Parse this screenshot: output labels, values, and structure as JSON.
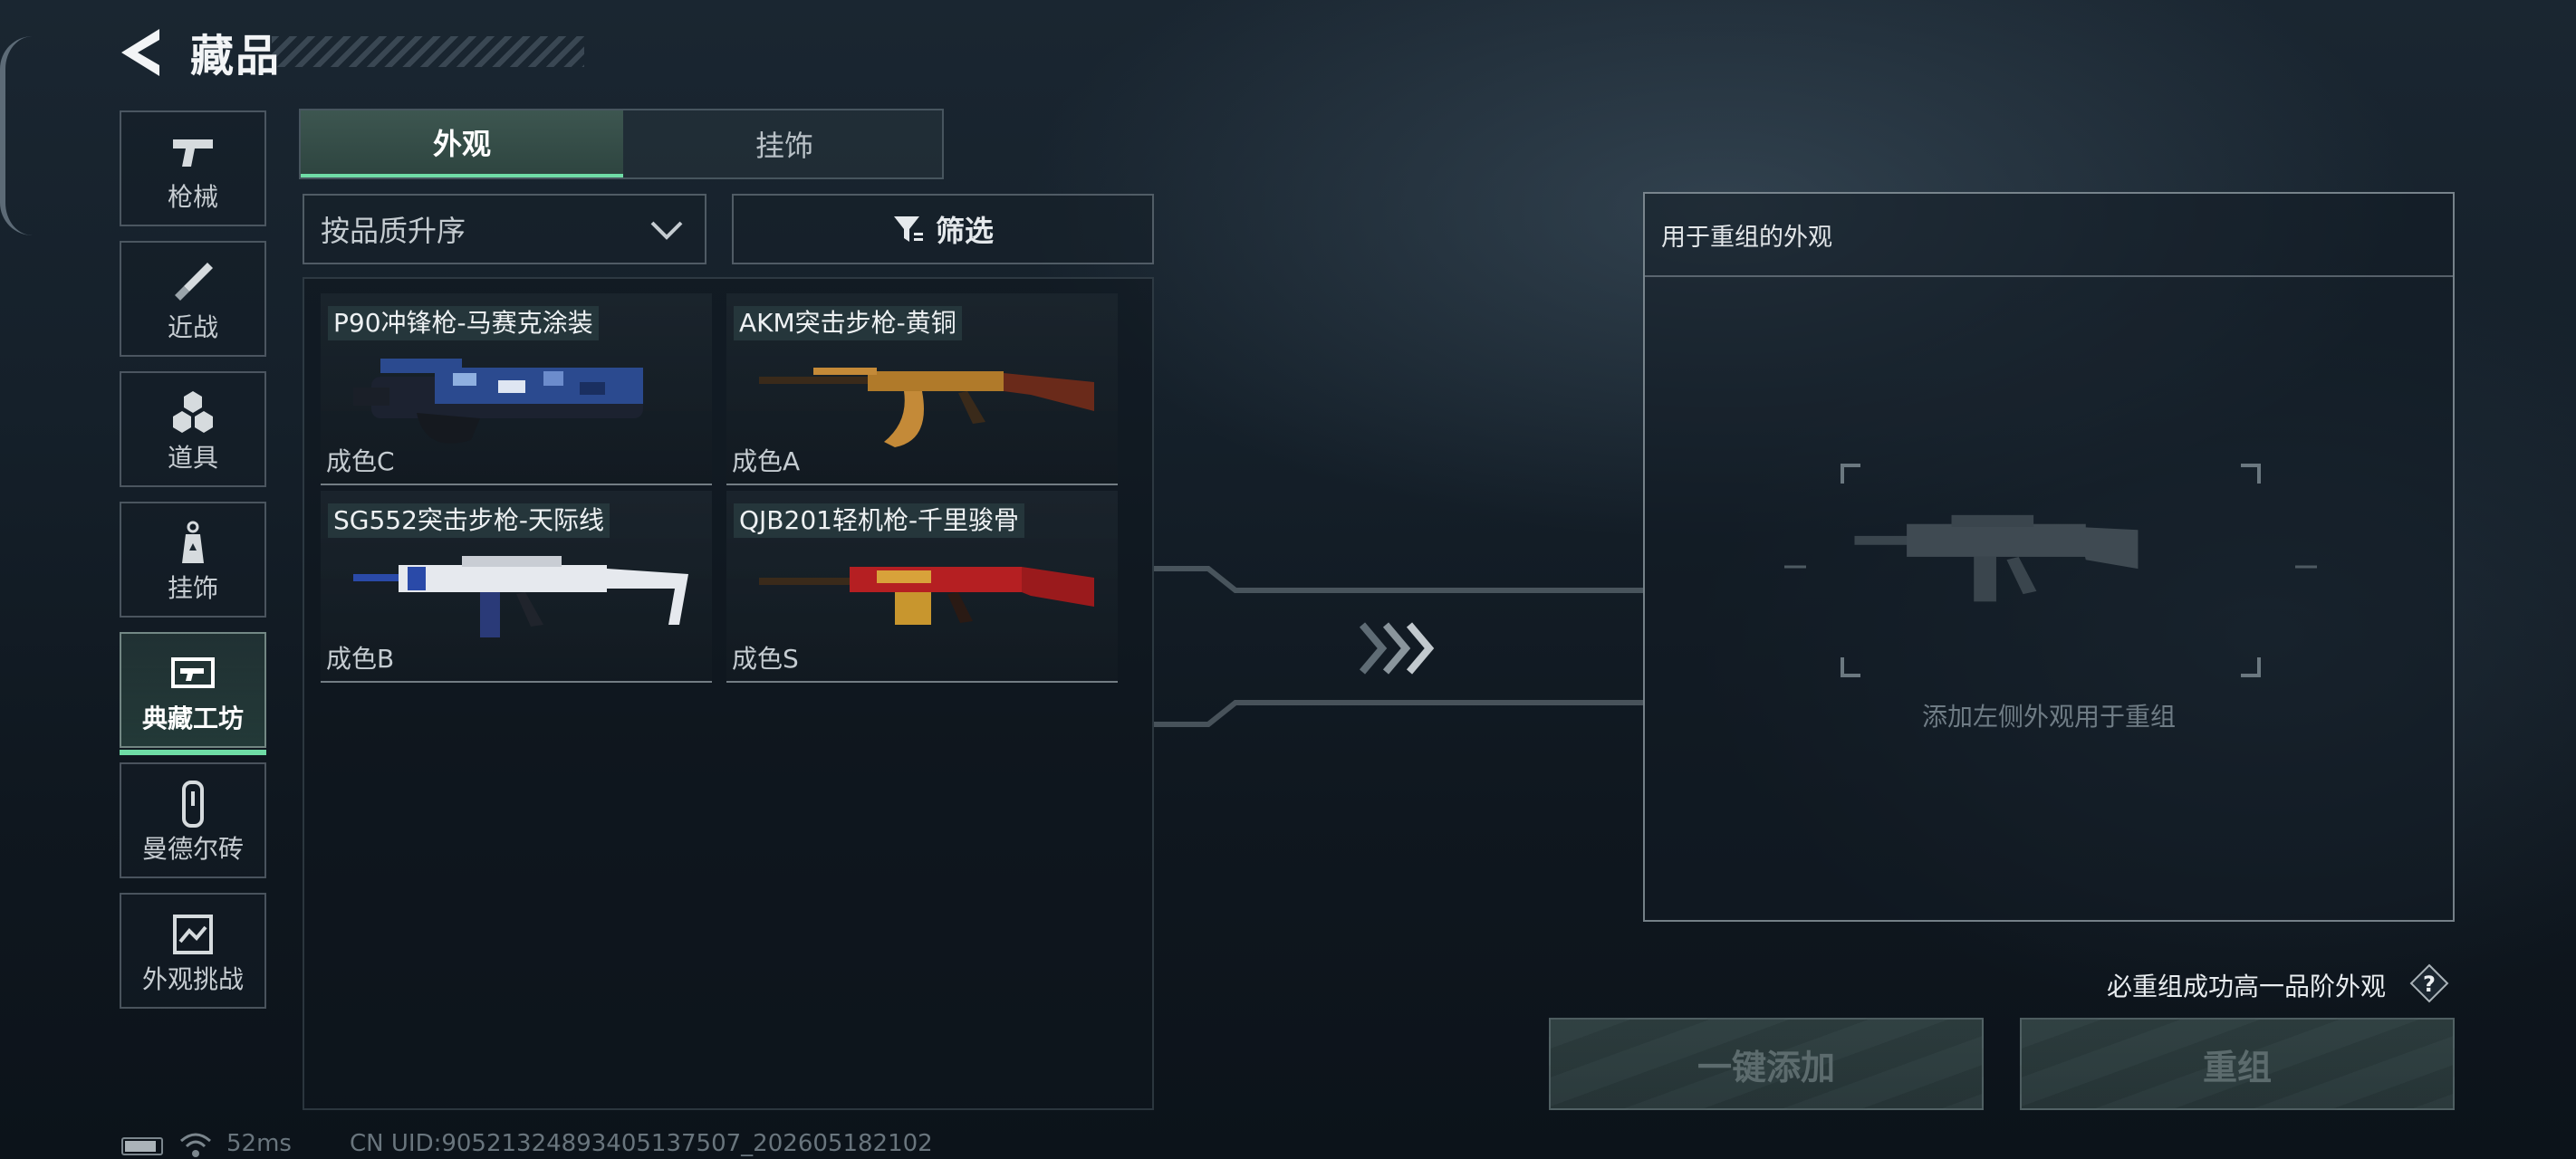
{
  "header": {
    "title": "藏品",
    "back_icon": "back-arrow-icon"
  },
  "sidebar": {
    "items": [
      {
        "label": "枪械",
        "icon": "pistol-icon"
      },
      {
        "label": "近战",
        "icon": "knife-icon"
      },
      {
        "label": "道具",
        "icon": "grenades-icon"
      },
      {
        "label": "挂饰",
        "icon": "charm-icon"
      },
      {
        "label": "典藏工坊",
        "icon": "workshop-icon",
        "active": true
      },
      {
        "label": "曼德尔砖",
        "icon": "brick-icon"
      },
      {
        "label": "外观挑战",
        "icon": "challenge-icon"
      }
    ]
  },
  "tabs": [
    {
      "label": "外观",
      "active": true
    },
    {
      "label": "挂饰",
      "active": false
    }
  ],
  "sort": {
    "selected": "按品质升序"
  },
  "filter": {
    "label": "筛选"
  },
  "items": [
    {
      "name": "P90冲锋枪-马赛克涂装",
      "grade": "成色C",
      "color": "#2b4a8f"
    },
    {
      "name": "AKM突击步枪-黄铜",
      "grade": "成色A",
      "color": "#b07a2a"
    },
    {
      "name": "SG552突击步枪-天际线",
      "grade": "成色B",
      "color": "#e6e9ee"
    },
    {
      "name": "QJB201轻机枪-千里骏骨",
      "grade": "成色S",
      "color": "#b51f22"
    }
  ],
  "recombine": {
    "header": "用于重组的外观",
    "hint": "添加左侧外观用于重组",
    "guarantee": "必重组成功高一品阶外观"
  },
  "buttons": {
    "add_all": "一键添加",
    "recombine": "重组"
  },
  "status": {
    "ping": "52ms",
    "uid": "CN UID:90521324893405137507_202605182102"
  },
  "colors": {
    "accent": "#6fdca6"
  }
}
